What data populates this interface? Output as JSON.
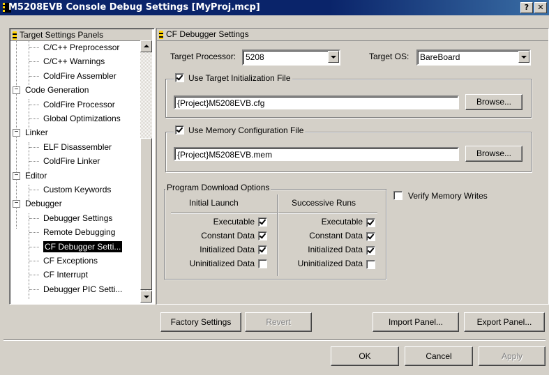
{
  "window": {
    "title": "M5208EVB Console Debug Settings [MyProj.mcp]",
    "help_glyph": "?",
    "close_glyph": "✕"
  },
  "tree": {
    "header": "Target Settings Panels",
    "items": [
      {
        "label": "C/C++ Preprocessor",
        "level": 1
      },
      {
        "label": "C/C++ Warnings",
        "level": 1
      },
      {
        "label": "ColdFire Assembler",
        "level": 1
      },
      {
        "label": "Code Generation",
        "level": 0,
        "expander": "−"
      },
      {
        "label": "ColdFire Processor",
        "level": 1
      },
      {
        "label": "Global Optimizations",
        "level": 1
      },
      {
        "label": "Linker",
        "level": 0,
        "expander": "−"
      },
      {
        "label": "ELF Disassembler",
        "level": 1
      },
      {
        "label": "ColdFire Linker",
        "level": 1
      },
      {
        "label": "Editor",
        "level": 0,
        "expander": "−"
      },
      {
        "label": "Custom Keywords",
        "level": 1
      },
      {
        "label": "Debugger",
        "level": 0,
        "expander": "−"
      },
      {
        "label": "Debugger Settings",
        "level": 1
      },
      {
        "label": "Remote Debugging",
        "level": 1
      },
      {
        "label": "CF Debugger Setti...",
        "level": 1,
        "selected": true
      },
      {
        "label": "CF Exceptions",
        "level": 1
      },
      {
        "label": "CF Interrupt",
        "level": 1
      },
      {
        "label": "Debugger PIC Setti...",
        "level": 1
      }
    ]
  },
  "panel": {
    "header": "CF Debugger Settings",
    "target_processor_label": "Target Processor:",
    "target_processor_value": "5208",
    "target_os_label": "Target OS:",
    "target_os_value": "BareBoard",
    "init_file": {
      "checkbox_label": "Use Target Initialization File",
      "checked": true,
      "path": "{Project}M5208EVB.cfg",
      "browse": "Browse..."
    },
    "mem_file": {
      "checkbox_label": "Use Memory Configuration File",
      "checked": true,
      "path": "{Project}M5208EVB.mem",
      "browse": "Browse..."
    },
    "download": {
      "group_title": "Program Download Options",
      "col1": "Initial Launch",
      "col2": "Successive Runs",
      "rows": [
        {
          "label": "Executable",
          "initial": true,
          "successive": true
        },
        {
          "label": "Constant Data",
          "initial": true,
          "successive": true
        },
        {
          "label": "Initialized Data",
          "initial": true,
          "successive": true
        },
        {
          "label": "Uninitialized Data",
          "initial": false,
          "successive": false
        }
      ]
    },
    "verify_label": "Verify Memory Writes",
    "verify_checked": false
  },
  "buttons": {
    "factory": "Factory Settings",
    "revert": "Revert",
    "import": "Import Panel...",
    "export": "Export Panel...",
    "ok": "OK",
    "cancel": "Cancel",
    "apply": "Apply"
  }
}
